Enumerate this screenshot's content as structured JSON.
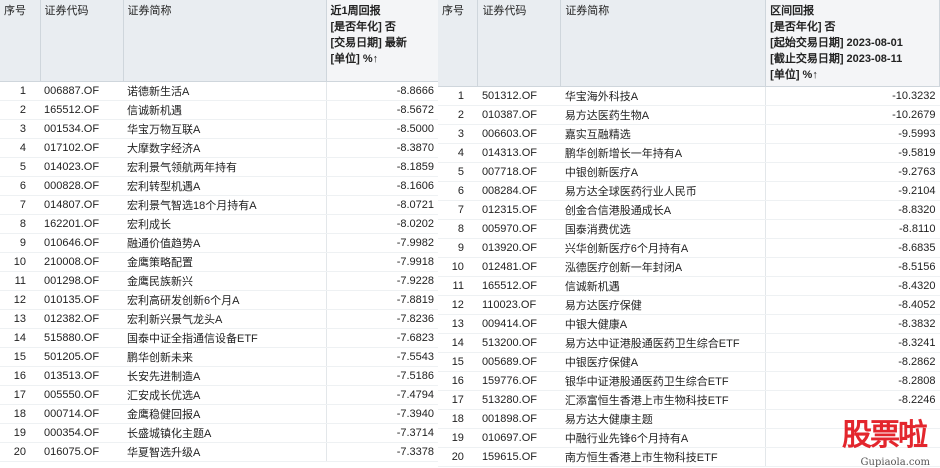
{
  "left": {
    "headers": {
      "idx": "序号",
      "code": "证券代码",
      "name": "证券简称",
      "ret_lines": [
        "近1周回报",
        "[是否年化] 否",
        "[交易日期] 最新",
        "[单位] %↑"
      ]
    },
    "rows": [
      [
        "1",
        "006887.OF",
        "诺德新生活A",
        "-8.8666"
      ],
      [
        "2",
        "165512.OF",
        "信诚新机遇",
        "-8.5672"
      ],
      [
        "3",
        "001534.OF",
        "华宝万物互联A",
        "-8.5000"
      ],
      [
        "4",
        "017102.OF",
        "大摩数字经济A",
        "-8.3870"
      ],
      [
        "5",
        "014023.OF",
        "宏利景气领航两年持有",
        "-8.1859"
      ],
      [
        "6",
        "000828.OF",
        "宏利转型机遇A",
        "-8.1606"
      ],
      [
        "7",
        "014807.OF",
        "宏利景气智选18个月持有A",
        "-8.0721"
      ],
      [
        "8",
        "162201.OF",
        "宏利成长",
        "-8.0202"
      ],
      [
        "9",
        "010646.OF",
        "融通价值趋势A",
        "-7.9982"
      ],
      [
        "10",
        "210008.OF",
        "金鹰策略配置",
        "-7.9918"
      ],
      [
        "11",
        "001298.OF",
        "金鹰民族新兴",
        "-7.9228"
      ],
      [
        "12",
        "010135.OF",
        "宏利高研发创新6个月A",
        "-7.8819"
      ],
      [
        "13",
        "012382.OF",
        "宏利新兴景气龙头A",
        "-7.8236"
      ],
      [
        "14",
        "515880.OF",
        "国泰中证全指通信设备ETF",
        "-7.6823"
      ],
      [
        "15",
        "501205.OF",
        "鹏华创新未来",
        "-7.5543"
      ],
      [
        "16",
        "013513.OF",
        "长安先进制造A",
        "-7.5186"
      ],
      [
        "17",
        "005550.OF",
        "汇安成长优选A",
        "-7.4794"
      ],
      [
        "18",
        "000714.OF",
        "金鹰稳健回报A",
        "-7.3940"
      ],
      [
        "19",
        "000354.OF",
        "长盛城镇化主题A",
        "-7.3714"
      ],
      [
        "20",
        "016075.OF",
        "华夏智选升级A",
        "-7.3378"
      ]
    ]
  },
  "right": {
    "headers": {
      "idx": "序号",
      "code": "证券代码",
      "name": "证券简称",
      "ret_lines": [
        "区间回报",
        "[是否年化] 否",
        "[起始交易日期] 2023-08-01",
        "[截止交易日期] 2023-08-11",
        "[单位] %↑"
      ]
    },
    "rows": [
      [
        "1",
        "501312.OF",
        "华宝海外科技A",
        "-10.3232"
      ],
      [
        "2",
        "010387.OF",
        "易方达医药生物A",
        "-10.2679"
      ],
      [
        "3",
        "006603.OF",
        "嘉实互融精选",
        "-9.5993"
      ],
      [
        "4",
        "014313.OF",
        "鹏华创新增长一年持有A",
        "-9.5819"
      ],
      [
        "5",
        "007718.OF",
        "中银创新医疗A",
        "-9.2763"
      ],
      [
        "6",
        "008284.OF",
        "易方达全球医药行业人民币",
        "-9.2104"
      ],
      [
        "7",
        "012315.OF",
        "创金合信港股通成长A",
        "-8.8320"
      ],
      [
        "8",
        "005970.OF",
        "国泰消费优选",
        "-8.8110"
      ],
      [
        "9",
        "013920.OF",
        "兴华创新医疗6个月持有A",
        "-8.6835"
      ],
      [
        "10",
        "012481.OF",
        "泓德医疗创新一年封闭A",
        "-8.5156"
      ],
      [
        "11",
        "165512.OF",
        "信诚新机遇",
        "-8.4320"
      ],
      [
        "12",
        "110023.OF",
        "易方达医疗保健",
        "-8.4052"
      ],
      [
        "13",
        "009414.OF",
        "中银大健康A",
        "-8.3832"
      ],
      [
        "14",
        "513200.OF",
        "易方达中证港股通医药卫生综合ETF",
        "-8.3241"
      ],
      [
        "15",
        "005689.OF",
        "中银医疗保健A",
        "-8.2862"
      ],
      [
        "16",
        "159776.OF",
        "银华中证港股通医药卫生综合ETF",
        "-8.2808"
      ],
      [
        "17",
        "513280.OF",
        "汇添富恒生香港上市生物科技ETF",
        "-8.2246"
      ],
      [
        "18",
        "001898.OF",
        "易方达大健康主题",
        ""
      ],
      [
        "19",
        "010697.OF",
        "中融行业先锋6个月持有A",
        ""
      ],
      [
        "20",
        "159615.OF",
        "南方恒生香港上市生物科技ETF",
        ""
      ]
    ]
  },
  "watermark": {
    "logo": "股票啦",
    "url": "Gupiaola.com"
  }
}
